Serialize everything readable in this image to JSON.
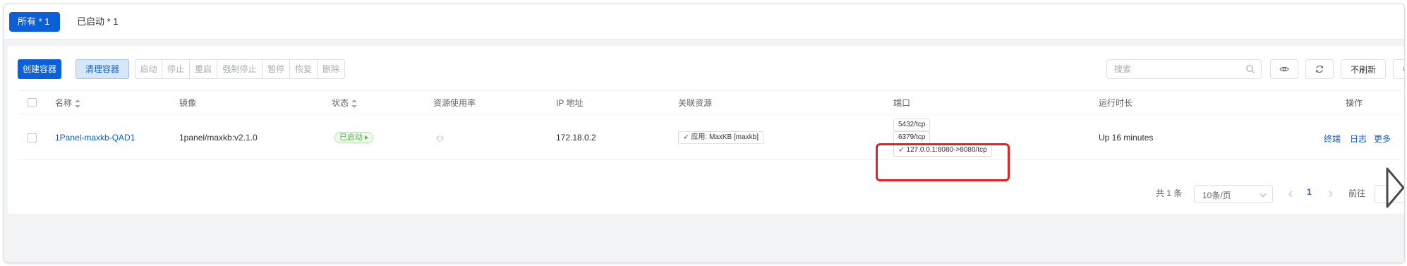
{
  "tabs": [
    {
      "label": "所有 * 1",
      "active": true
    },
    {
      "label": "已启动 * 1",
      "active": false
    }
  ],
  "toolbar": {
    "create_label": "创建容器",
    "clean_label": "清理容器",
    "actions": [
      "启动",
      "停止",
      "重启",
      "强制停止",
      "暂停",
      "恢复",
      "删除"
    ],
    "search_placeholder": "搜索",
    "refresh_label": "不刷新"
  },
  "table": {
    "headers": {
      "name": "名称",
      "image": "镜像",
      "status": "状态",
      "resource": "资源使用率",
      "ip": "IP 地址",
      "related": "关联资源",
      "ports": "端口",
      "uptime": "运行时长",
      "actions": "操作"
    },
    "rows": [
      {
        "name": "1Panel-maxkb-QAD1",
        "image": "1panel/maxkb:v2.1.0",
        "status": "已启动",
        "ip": "172.18.0.2",
        "related": "应用: MaxKB [maxkb]",
        "ports": [
          "5432/tcp",
          "6379/tcp",
          "127.0.0.1:8080->8080/tcp"
        ],
        "uptime": "Up 16 minutes",
        "ops": [
          "终端",
          "日志",
          "更多"
        ]
      }
    ]
  },
  "pagination": {
    "total": "共 1 条",
    "page_size": "10条/页",
    "current_page": "1",
    "goto_label": "前往"
  },
  "colors": {
    "primary": "#0b5fd8",
    "success": "#52b65a",
    "highlight": "#e02424"
  }
}
